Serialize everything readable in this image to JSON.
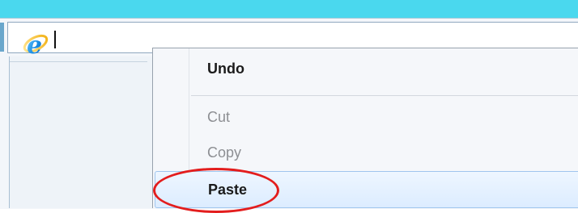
{
  "address_bar": {
    "value": ""
  },
  "context_menu": {
    "items": [
      {
        "label": "Undo",
        "state": "enabled"
      },
      {
        "label": "Cut",
        "state": "disabled"
      },
      {
        "label": "Copy",
        "state": "disabled"
      },
      {
        "label": "Paste",
        "state": "hovered"
      }
    ]
  },
  "colors": {
    "background_accent": "#4ad8ee",
    "highlight_oval": "#e31d1d",
    "hover_fill": "#dcecff"
  },
  "icons": {
    "browser_icon": "internet-explorer-icon"
  }
}
